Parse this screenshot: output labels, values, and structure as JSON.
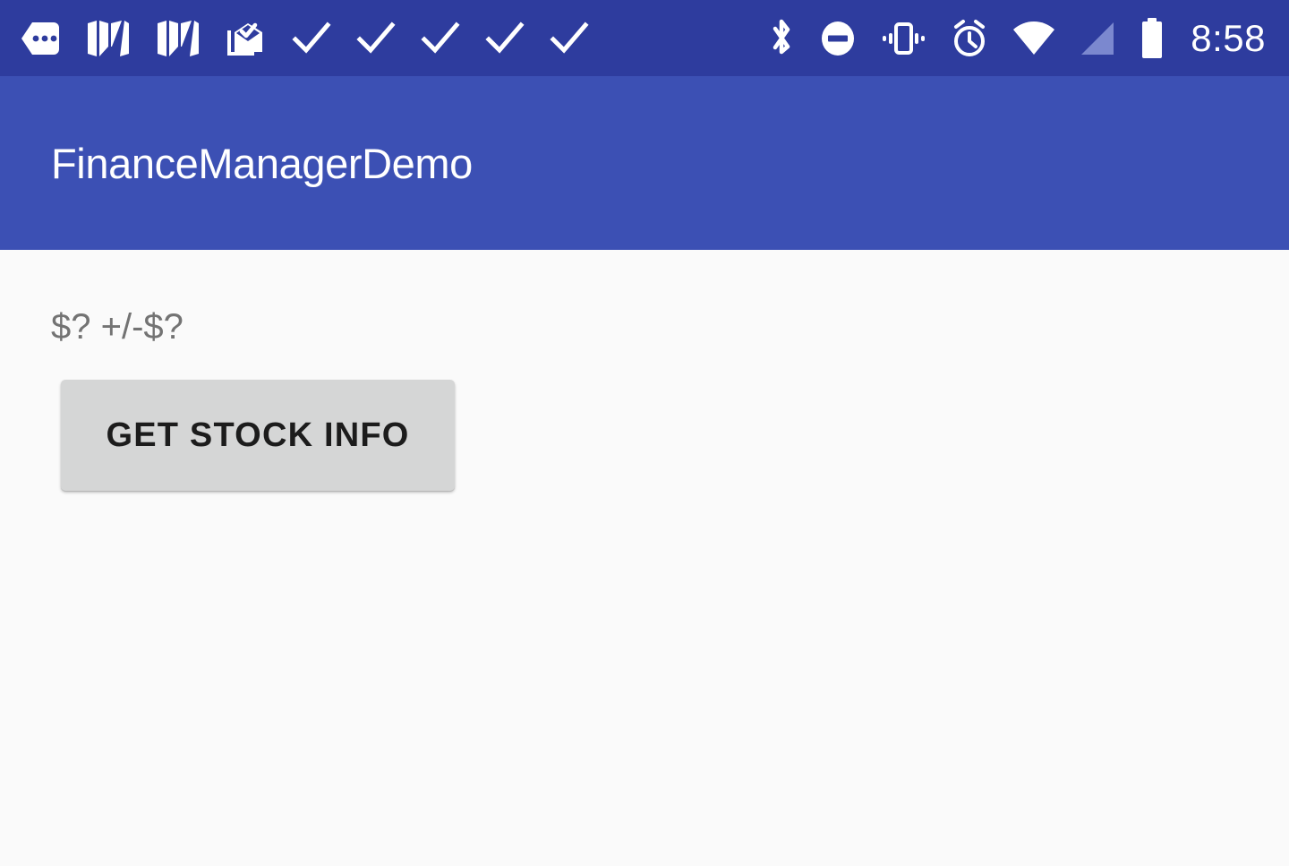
{
  "status_bar": {
    "background_color": "#2e3c9e",
    "time": "8:58",
    "left_icons": [
      {
        "name": "messages-icon",
        "label": "Messages"
      },
      {
        "name": "gmail-icon",
        "label": "Gmail"
      },
      {
        "name": "gmail-icon-2",
        "label": "Gmail"
      },
      {
        "name": "mail-open-check-icon",
        "label": "Mail"
      },
      {
        "name": "check-icon-1",
        "label": "Check"
      },
      {
        "name": "check-icon-2",
        "label": "Check"
      },
      {
        "name": "check-icon-3",
        "label": "Check"
      },
      {
        "name": "check-icon-4",
        "label": "Check"
      },
      {
        "name": "check-icon-5",
        "label": "Check"
      }
    ],
    "right_icons": [
      {
        "name": "bluetooth-icon",
        "label": "Bluetooth"
      },
      {
        "name": "do-not-disturb-icon",
        "label": "Do not disturb"
      },
      {
        "name": "vibrate-icon",
        "label": "Vibrate"
      },
      {
        "name": "alarm-icon",
        "label": "Alarm set"
      },
      {
        "name": "wifi-icon",
        "label": "Wi-Fi"
      },
      {
        "name": "cellular-signal-icon",
        "label": "No cellular signal"
      },
      {
        "name": "battery-icon",
        "label": "Battery full"
      }
    ]
  },
  "app_bar": {
    "title": "FinanceManagerDemo",
    "background_color": "#3c50b4",
    "title_color": "#ffffff"
  },
  "main": {
    "background_color": "#fafafa",
    "stock_price_label": "$? +/-$?",
    "stock_price_color": "#737373",
    "get_stock_info_button": {
      "label": "GET STOCK INFO",
      "background_color": "#d5d6d6",
      "text_color": "#1c1c1c"
    }
  }
}
